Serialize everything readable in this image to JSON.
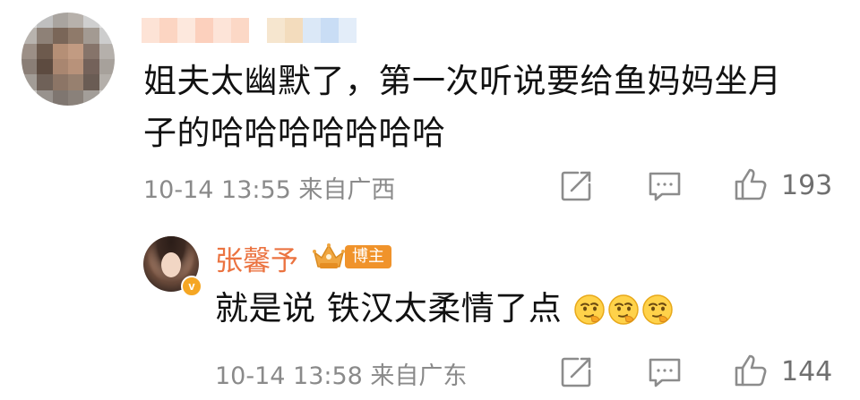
{
  "comments": [
    {
      "avatar": "pixelated-avatar",
      "username": "",
      "text_line1": "姐夫太幽默了，第一次听说要给鱼妈妈坐月",
      "text_line2": "子的哈哈哈哈哈哈哈",
      "time": "10-14 13:55",
      "location": "来自广西",
      "meta": "10-14 13:55  来自广西",
      "icons": [
        "share-icon",
        "reply-icon",
        "like-icon"
      ],
      "likes": "193"
    },
    {
      "avatar": "woman-photo-avatar",
      "verified_icon": "v-verified-icon",
      "username": "张馨予",
      "crown_icon": "crown-icon",
      "badge": "博主",
      "text": "就是说 铁汉太柔情了点",
      "emoji": [
        "thinking-face-icon",
        "thinking-face-icon",
        "thinking-face-icon"
      ],
      "time": "10-14 13:58",
      "location": "来自广东",
      "meta": "10-14 13:58  来自广东",
      "icons": [
        "share-icon",
        "reply-icon",
        "like-icon"
      ],
      "likes": "144"
    }
  ],
  "colors": {
    "username_reply": "#eb7340",
    "badge_bg": "#f0932b",
    "meta_text": "#8a8a8a",
    "verified_badge": "#f5a623"
  }
}
